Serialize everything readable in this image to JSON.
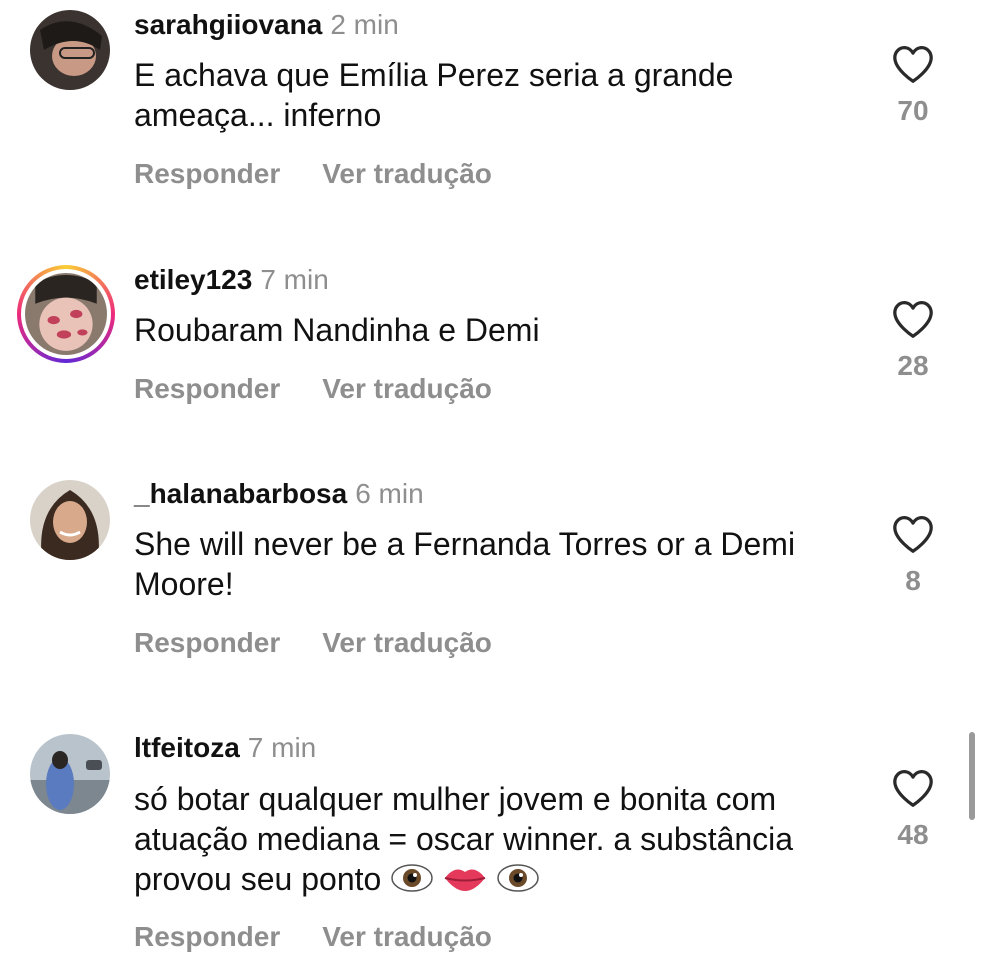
{
  "comments": [
    {
      "username": "sarahgiiovana",
      "time": "2 min",
      "text": "E achava que Emília Perez seria a grande ameaça... inferno",
      "reply_label": "Responder",
      "translate_label": "Ver tradução",
      "likes": "70",
      "has_story": false
    },
    {
      "username": "etiley123",
      "time": "7 min",
      "text": "Roubaram Nandinha e Demi",
      "reply_label": "Responder",
      "translate_label": "Ver tradução",
      "likes": "28",
      "has_story": true
    },
    {
      "username": "_halanabarbosa",
      "time": "6 min",
      "text": "She will never be a Fernanda Torres or a Demi Moore!",
      "reply_label": "Responder",
      "translate_label": "Ver tradução",
      "likes": "8",
      "has_story": false
    },
    {
      "username": "ltfeitoza",
      "time": "7 min",
      "text": "só botar qualquer mulher jovem e bonita com atuação mediana = oscar winner. a substância provou seu ponto",
      "emojis": [
        "eyes",
        "lips",
        "eyes"
      ],
      "reply_label": "Responder",
      "translate_label": "Ver tradução",
      "likes": "48",
      "has_story": false
    }
  ],
  "colors": {
    "text": "#111111",
    "muted": "#8e8e8e",
    "story_ring": [
      "#f9ce34",
      "#ee2a7b",
      "#6228d7"
    ]
  },
  "icons": {
    "like": "heart-outline-icon"
  }
}
